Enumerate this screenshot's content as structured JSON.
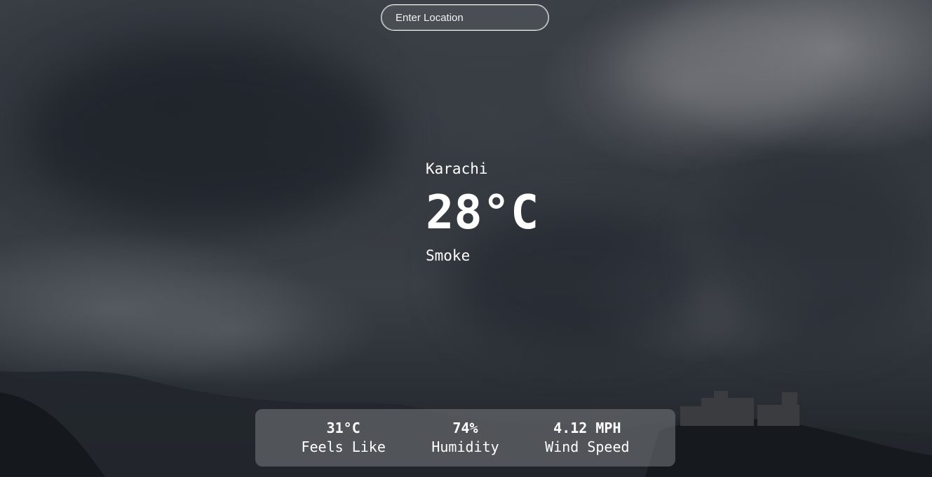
{
  "search": {
    "placeholder": "Enter Location"
  },
  "weather": {
    "city": "Karachi",
    "temperature": "28°C",
    "condition": "Smoke"
  },
  "stats": {
    "feels_like": {
      "value": "31°C",
      "label": "Feels Like"
    },
    "humidity": {
      "value": "74%",
      "label": "Humidity"
    },
    "wind_speed": {
      "value": "4.12 MPH",
      "label": "Wind Speed"
    }
  },
  "colors": {
    "text": "#ffffff",
    "panel": "#787c80",
    "sky_dark": "#2a2f35",
    "sky_light": "#828488"
  },
  "background": {
    "scene": "stormy-clouds-over-hills-with-castle"
  }
}
